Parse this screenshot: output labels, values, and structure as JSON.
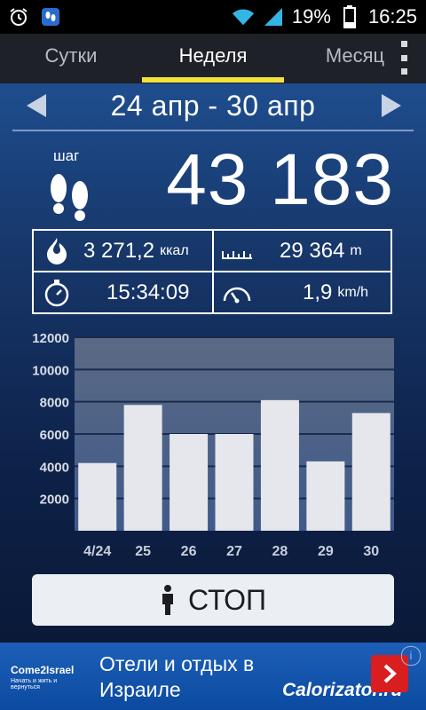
{
  "status_bar": {
    "battery": "19%",
    "time": "16:25"
  },
  "tabs": [
    {
      "label": "Сутки",
      "active": false
    },
    {
      "label": "Неделя",
      "active": true
    },
    {
      "label": "Месяц",
      "active": false
    }
  ],
  "date_range": "24 апр - 30 апр",
  "steps": {
    "label": "шаг",
    "value": "43 183"
  },
  "stats": {
    "calories": {
      "value": "3 271,2",
      "unit": "ккал"
    },
    "distance": {
      "value": "29 364",
      "unit": "m"
    },
    "time": {
      "value": "15:34:09"
    },
    "speed": {
      "value": "1,9",
      "unit": "km/h"
    }
  },
  "chart_data": {
    "type": "bar",
    "categories": [
      "4/24",
      "25",
      "26",
      "27",
      "28",
      "29",
      "30"
    ],
    "values": [
      4200,
      7800,
      6000,
      6000,
      8100,
      4300,
      7300
    ],
    "ylim": [
      0,
      12000
    ],
    "yticks": [
      "12000",
      "10000",
      "8000",
      "6000",
      "4000",
      "2000"
    ],
    "grid": true,
    "colors": {
      "bar": "#e6e7ec",
      "plot_bg_top": "#5b6a84",
      "plot_bg_bottom": "#3f5a8b"
    }
  },
  "stop_button": {
    "label": "СТОП"
  },
  "ad": {
    "logo_name": "Come2Israel",
    "logo_tagline": "Начать и жить и вернуться",
    "text": "Отели и отдых в Израиле",
    "brand": "Calorizator.ru"
  },
  "colors": {
    "accent": "#f4e23b",
    "tab_bg": "#1e2127",
    "ad_button": "#d81e1e"
  }
}
